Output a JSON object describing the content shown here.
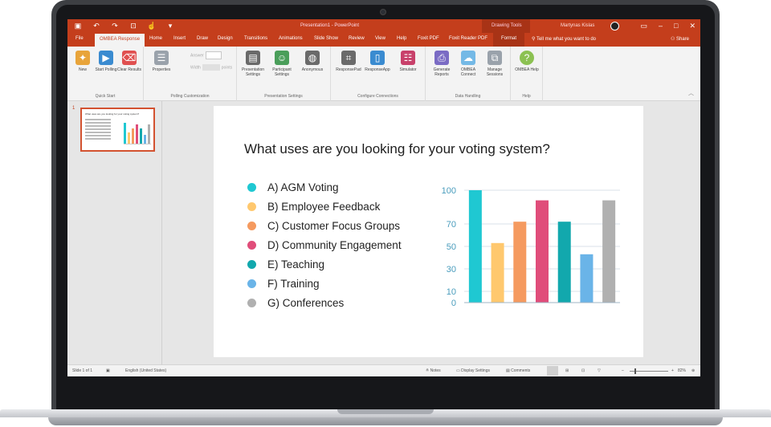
{
  "window": {
    "title": "Presentation1 - PowerPoint",
    "context_tab_group": "Drawing Tools",
    "user_name": "Martynas Kislas",
    "qat_icons": [
      "save-icon",
      "undo-icon",
      "redo-icon",
      "present-icon",
      "touch-mode-icon",
      "customize-icon"
    ]
  },
  "tabs": [
    "File",
    "OMBEA Response",
    "Home",
    "Insert",
    "Draw",
    "Design",
    "Transitions",
    "Animations",
    "Slide Show",
    "Review",
    "View",
    "Help",
    "Foxit PDF",
    "Foxit Reader PDF",
    "Format"
  ],
  "tell_me": "Tell me what you want to do",
  "share": "Share",
  "ribbon": {
    "groups": [
      {
        "label": "Quick Start",
        "buttons": [
          "New",
          "Start Polling",
          "Clear Results"
        ]
      },
      {
        "label": "Polling Customization",
        "buttons": [
          "Properties"
        ],
        "answer_label": "Answer",
        "width_label": "Width",
        "points_label": "points"
      },
      {
        "label": "Presentation Settings",
        "buttons": [
          "Presentation Settings",
          "Participant Settings",
          "Anonymous"
        ]
      },
      {
        "label": "Configure Connections",
        "buttons": [
          "ResponsePad",
          "ResponseApp",
          "Simulator"
        ]
      },
      {
        "label": "Data Handling",
        "buttons": [
          "Generate Reports",
          "OMBEA Connect",
          "Manage Sessions"
        ]
      },
      {
        "label": "Help",
        "buttons": [
          "OMBEA Help"
        ]
      }
    ]
  },
  "thumbnail": {
    "number": "1"
  },
  "slide": {
    "title": "What uses are you looking for your voting system?",
    "options": [
      {
        "label": "A)  AGM Voting",
        "color": "#1fc8d2"
      },
      {
        "label": "B)  Employee Feedback",
        "color": "#ffc86e"
      },
      {
        "label": "C)  Customer Focus Groups",
        "color": "#f59a5f"
      },
      {
        "label": "D)  Community Engagement",
        "color": "#e04d7a"
      },
      {
        "label": "E)  Teaching",
        "color": "#12a8ad"
      },
      {
        "label": "F)  Training",
        "color": "#6ab4e8"
      },
      {
        "label": "G)  Conferences",
        "color": "#b0b0b0"
      }
    ]
  },
  "chart_data": {
    "type": "bar",
    "categories": [
      "A",
      "B",
      "C",
      "D",
      "E",
      "F",
      "G"
    ],
    "values": [
      100,
      53,
      72,
      91,
      72,
      43,
      91
    ],
    "colors": [
      "#1fc8d2",
      "#ffc86e",
      "#f59a5f",
      "#e04d7a",
      "#12a8ad",
      "#6ab4e8",
      "#b0b0b0"
    ],
    "yticks": [
      "0",
      "10",
      "30",
      "50",
      "70",
      "100"
    ],
    "grid": true
  },
  "status": {
    "slide_counter": "Slide 1 of 1",
    "language": "English (United States)",
    "notes": "Notes",
    "display_settings": "Display Settings",
    "comments": "Comments",
    "zoom": "82%"
  }
}
